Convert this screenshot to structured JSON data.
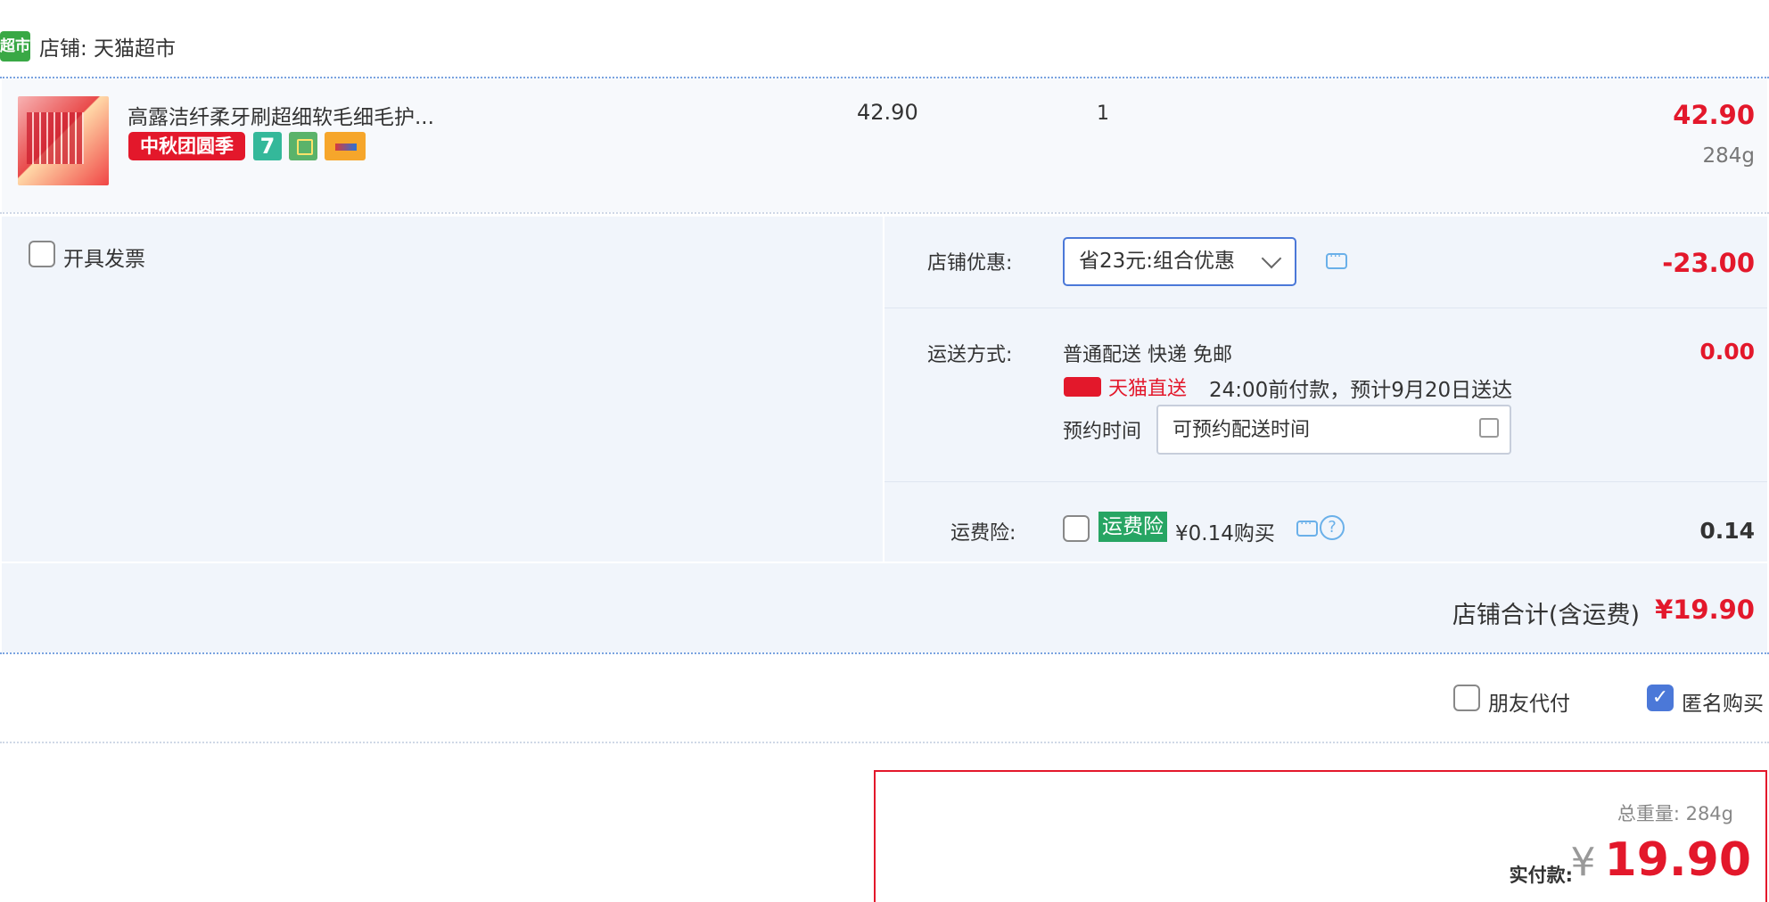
{
  "store": {
    "logo_text": "超市",
    "name": "店铺: 天猫超市"
  },
  "item": {
    "title": "高露洁纤柔牙刷超细软毛细毛护...",
    "promo_tag": "中秋团圆季",
    "service_tag_7": "7",
    "unit_price": "42.90",
    "quantity": "1",
    "subtotal": "42.90",
    "weight": "284g"
  },
  "options": {
    "invoice_label": "开具发票",
    "coupon": {
      "label": "店铺优惠:",
      "selected": "省23元:组合优惠",
      "amount": "-23.00"
    },
    "shipping": {
      "label": "运送方式:",
      "method": "普通配送 快递 免邮",
      "fee": "0.00",
      "tmall_direct": "天猫直送",
      "arrival": "24:00前付款，预计9月20日送达",
      "reserve_label": "预约时间",
      "reserve_placeholder": "可预约配送时间"
    },
    "insurance": {
      "label": "运费险:",
      "tag": "运费险",
      "price_text": "¥0.14购买",
      "amount": "0.14"
    }
  },
  "store_total": {
    "label": "店铺合计(含运费)",
    "value": "¥19.90"
  },
  "payment_options": {
    "friend_pay": "朋友代付",
    "anonymous": "匿名购买",
    "anonymous_checked": true
  },
  "summary": {
    "total_weight": "总重量: 284g",
    "pay_label": "实付款:",
    "currency": "¥",
    "pay_amount": "19.90"
  },
  "colors": {
    "accent_red": "#e3182b",
    "blue": "#4b78d8",
    "bg_light": "#f1f5fb",
    "green": "#27a563"
  }
}
